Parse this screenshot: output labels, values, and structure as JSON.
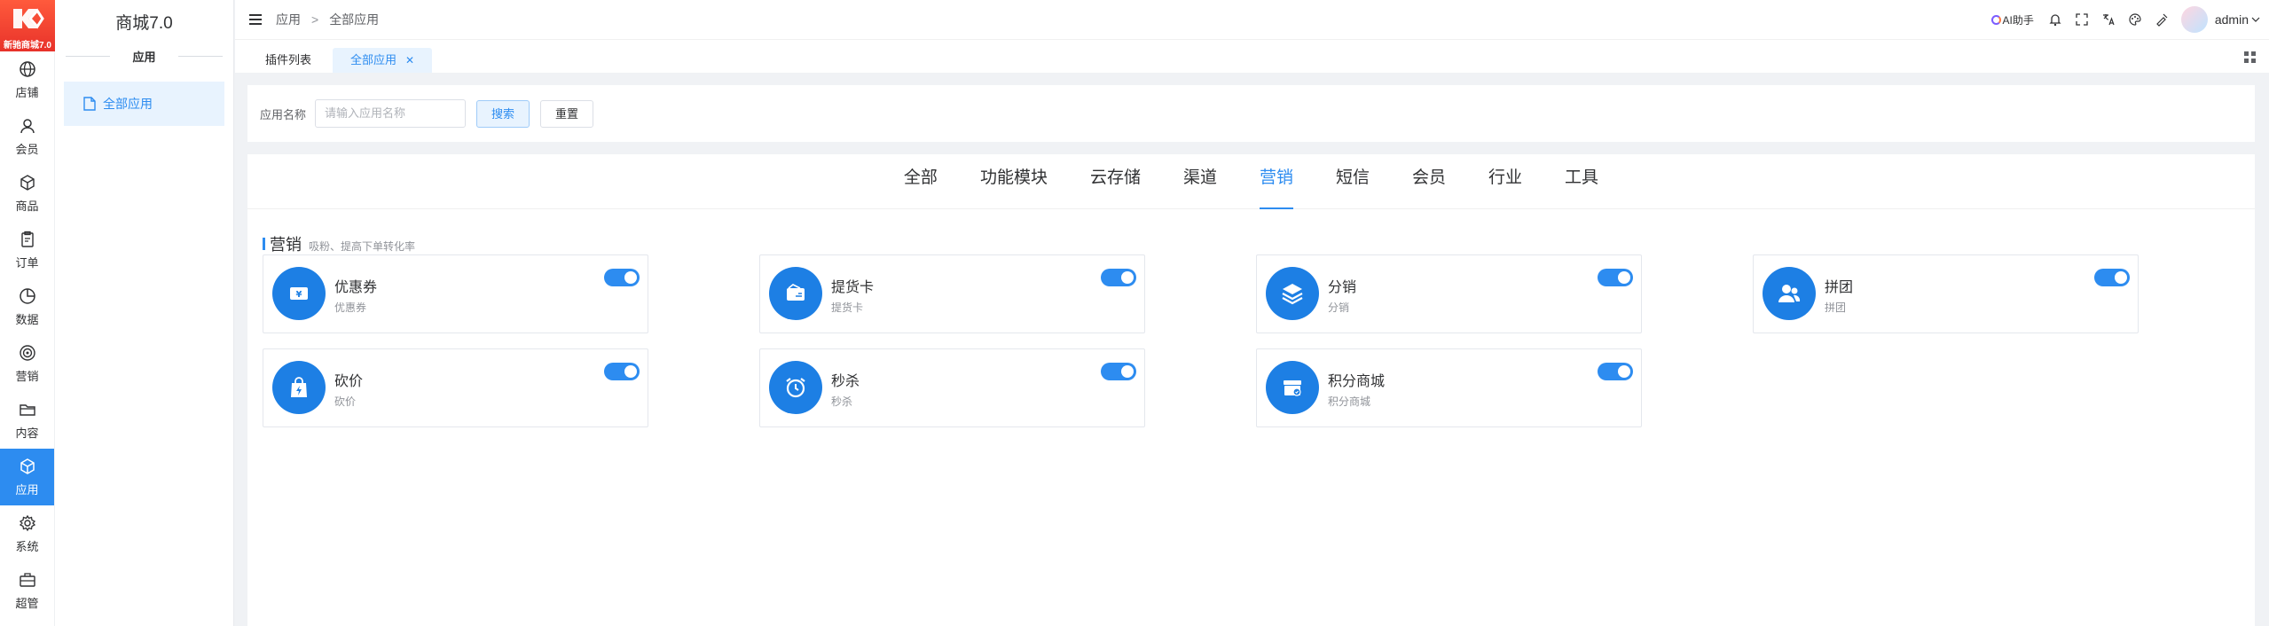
{
  "brand": {
    "badge": "新驰商城7.0"
  },
  "rail": [
    {
      "label": "店铺",
      "icon": "globe-icon"
    },
    {
      "label": "会员",
      "icon": "user-icon"
    },
    {
      "label": "商品",
      "icon": "box-icon"
    },
    {
      "label": "订单",
      "icon": "clipboard-icon"
    },
    {
      "label": "数据",
      "icon": "pie-chart-icon"
    },
    {
      "label": "营销",
      "icon": "target-icon"
    },
    {
      "label": "内容",
      "icon": "folder-icon"
    },
    {
      "label": "应用",
      "icon": "cube-icon",
      "active": true
    },
    {
      "label": "系统",
      "icon": "gear-icon"
    },
    {
      "label": "超管",
      "icon": "briefcase-icon"
    }
  ],
  "sidebar": {
    "title": "商城7.0",
    "section": "应用",
    "item": "全部应用"
  },
  "header": {
    "crumb1": "应用",
    "separator": ">",
    "crumb2": "全部应用",
    "ai": "AI助手",
    "user": "admin"
  },
  "tabs": [
    {
      "label": "插件列表"
    },
    {
      "label": "全部应用",
      "active": true
    }
  ],
  "search": {
    "label": "应用名称",
    "placeholder": "请输入应用名称",
    "search_btn": "搜索",
    "reset_btn": "重置"
  },
  "categories": [
    "全部",
    "功能模块",
    "云存储",
    "渠道",
    "营销",
    "短信",
    "会员",
    "行业",
    "工具"
  ],
  "active_category": "营销",
  "section": {
    "title": "营销",
    "desc": "吸粉、提高下单转化率"
  },
  "apps": [
    {
      "name": "优惠券",
      "desc": "优惠券",
      "icon": "coupon-icon",
      "enabled": true
    },
    {
      "name": "提货卡",
      "desc": "提货卡",
      "icon": "card-icon",
      "enabled": true
    },
    {
      "name": "分销",
      "desc": "分销",
      "icon": "layers-icon",
      "enabled": true
    },
    {
      "name": "拼团",
      "desc": "拼团",
      "icon": "group-icon",
      "enabled": true
    },
    {
      "name": "砍价",
      "desc": "砍价",
      "icon": "bag-icon",
      "enabled": true
    },
    {
      "name": "秒杀",
      "desc": "秒杀",
      "icon": "alarm-icon",
      "enabled": true
    },
    {
      "name": "积分商城",
      "desc": "积分商城",
      "icon": "store-icon",
      "enabled": true
    }
  ],
  "colors": {
    "accent": "#2d8cf0",
    "icon_bg": "#1d7fe4",
    "brand": "#ee3a2c"
  }
}
